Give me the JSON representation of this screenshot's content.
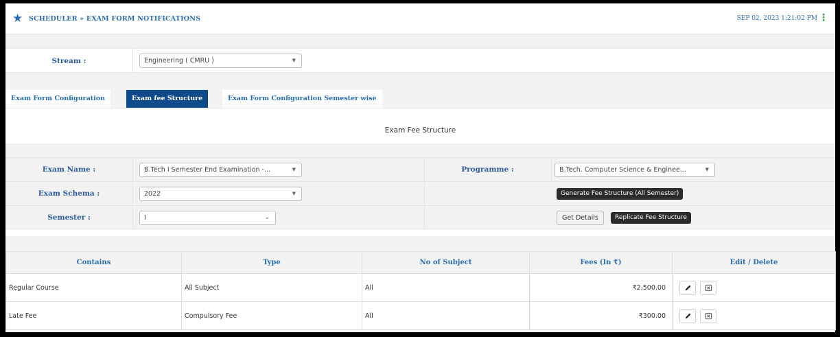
{
  "header": {
    "breadcrumb": "SCHEDULER » EXAM FORM NOTIFICATIONS",
    "datetime": "SEP 02, 2023  1:21:02 PM"
  },
  "stream": {
    "label": "Stream :",
    "value": "Engineering ( CMRU )"
  },
  "tabs": [
    {
      "label": "Exam Form Configuration",
      "active": false
    },
    {
      "label": "Exam fee Structure",
      "active": true
    },
    {
      "label": "Exam Form Configuration Semester wise",
      "active": false
    }
  ],
  "content": {
    "title": "Exam Fee Structure"
  },
  "form": {
    "exam_name": {
      "label": "Exam Name :",
      "value": "B.Tech I Semester End Examination -..."
    },
    "programme": {
      "label": "Programme :",
      "value": "B.Tech. Computer Science & Enginee..."
    },
    "exam_schema": {
      "label": "Exam Schema :",
      "value": "2022"
    },
    "semester": {
      "label": "Semester :",
      "value": "I"
    },
    "generate_button": "Generate Fee Structure (All Semester)",
    "get_details_button": "Get Details",
    "replicate_button": "Replicate Fee Structure"
  },
  "table": {
    "headers": [
      "Contains",
      "Type",
      "No of Subject",
      "Fees (In ₹)",
      "Edit / Delete"
    ],
    "rows": [
      {
        "contains": "Regular Course",
        "type": "All Subject",
        "subjects": "All",
        "fees": "₹2,500.00"
      },
      {
        "contains": "Late Fee",
        "type": "Compulsory Fee",
        "subjects": "All",
        "fees": "₹300.00"
      }
    ]
  },
  "colors": {
    "primary": "#2a6db3",
    "active_tab": "#0f4a8a",
    "dark_button": "#2b2b2b",
    "kebab": "#37a04a"
  },
  "icons": [
    "star-icon",
    "kebab-menu-icon",
    "chevron-down-icon",
    "pencil-icon",
    "delete-icon"
  ]
}
